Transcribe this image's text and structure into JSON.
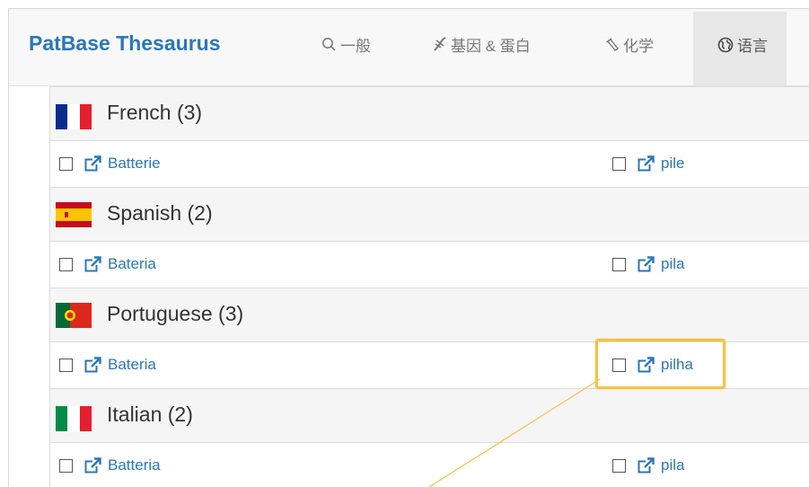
{
  "header": {
    "brand": "PatBase Thesaurus",
    "nav": [
      {
        "label": "一般",
        "icon": "search-icon"
      },
      {
        "label": "基因 & 蛋白",
        "icon": "dna-icon"
      },
      {
        "label": "化学",
        "icon": "flask-icon"
      },
      {
        "label": "语言",
        "icon": "globe-icon"
      }
    ],
    "active_tab": "语言"
  },
  "languages": [
    {
      "name": "French",
      "title": "French (3)",
      "count": 3,
      "flag": "flag-france-icon",
      "terms": [
        "Batterie",
        "pile"
      ]
    },
    {
      "name": "Spanish",
      "title": "Spanish (2)",
      "count": 2,
      "flag": "flag-spain-icon",
      "terms": [
        "Bateria",
        "pila"
      ]
    },
    {
      "name": "Portuguese",
      "title": "Portuguese (3)",
      "count": 3,
      "flag": "flag-portugal-icon",
      "terms": [
        "Bateria",
        "pilha"
      ]
    },
    {
      "name": "Italian",
      "title": "Italian (2)",
      "count": 2,
      "flag": "flag-italy-icon",
      "terms": [
        "Batteria",
        "pila"
      ]
    }
  ],
  "highlighted_term": "pilha",
  "colors": {
    "brand": "#2a77b9",
    "link": "#2a77b9",
    "highlight": "#f5c342",
    "nav_active_bg": "#e7e7e7"
  }
}
